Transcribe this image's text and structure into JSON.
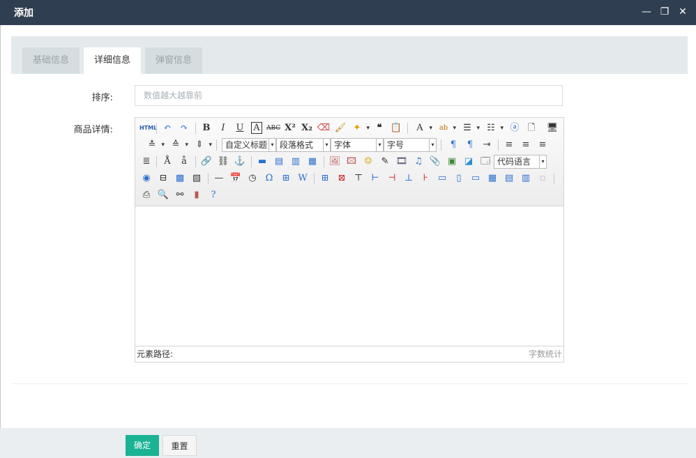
{
  "window": {
    "title": "添加",
    "minimize": "—",
    "maximize": "❐",
    "close": "✕"
  },
  "tabs": [
    {
      "label": "基础信息",
      "active": false
    },
    {
      "label": "详细信息",
      "active": true
    },
    {
      "label": "弹窗信息",
      "active": false
    }
  ],
  "form": {
    "sort_label": "排序:",
    "sort_placeholder": "数值越大越靠前",
    "detail_label": "商品详情:"
  },
  "editor": {
    "combos": {
      "custom_title": "自定义标题",
      "paragraph": "段落格式",
      "font": "字体",
      "font_size": "字号",
      "code_lang": "代码语言"
    },
    "status_path": "元素路径:",
    "word_count": "字数统计"
  },
  "footer": {
    "ok_label": "确定",
    "reset_label": "重置"
  },
  "colors": {
    "titlebar": "#2f3e50",
    "accent": "#1ab394"
  }
}
